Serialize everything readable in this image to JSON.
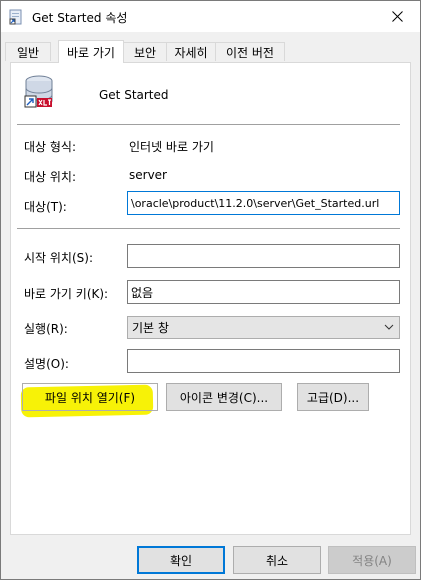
{
  "window": {
    "title": "Get Started 속성"
  },
  "tabs": [
    {
      "label": "일반"
    },
    {
      "label": "바로 가기"
    },
    {
      "label": "보안"
    },
    {
      "label": "자세히"
    },
    {
      "label": "이전 버전"
    }
  ],
  "shortcut": {
    "name": "Get Started"
  },
  "fields": {
    "target_type_label": "대상 형식:",
    "target_type_value": "인터넷 바로 가기",
    "target_location_label": "대상 위치:",
    "target_location_value": "server",
    "target_label": "대상(T):",
    "target_value": "\\oracle\\product\\11.2.0\\server\\Get_Started.url",
    "start_in_label": "시작 위치(S):",
    "start_in_value": "",
    "shortcut_key_label": "바로 가기 키(K):",
    "shortcut_key_value": "없음",
    "run_label": "실행(R):",
    "run_value": "기본 창",
    "comment_label": "설명(O):",
    "comment_value": ""
  },
  "buttons": {
    "open_location": "파일 위치 열기(F)",
    "change_icon": "아이콘 변경(C)...",
    "advanced": "고급(D)...",
    "ok": "확인",
    "cancel": "취소",
    "apply": "적용(A)"
  },
  "colors": {
    "highlight": "#f7f207",
    "focus": "#0078d7"
  }
}
